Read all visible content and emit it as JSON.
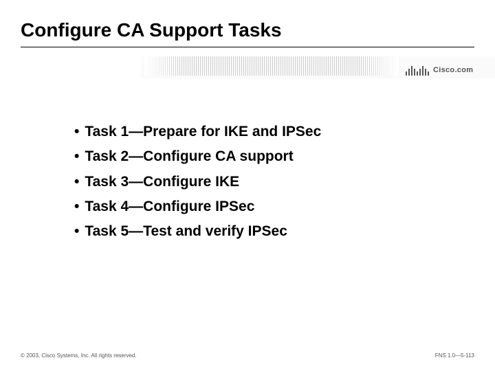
{
  "title": "Configure CA Support Tasks",
  "logo_text": "Cisco.com",
  "bullets": [
    "Task 1—Prepare for IKE and IPSec",
    "Task 2—Configure CA support",
    "Task 3—Configure IKE",
    "Task 4—Configure IPSec",
    "Task 5—Test and verify IPSec"
  ],
  "footer": {
    "left": "© 2003, Cisco Systems, Inc. All rights reserved.",
    "right": "FNS 1.0—5-113"
  }
}
